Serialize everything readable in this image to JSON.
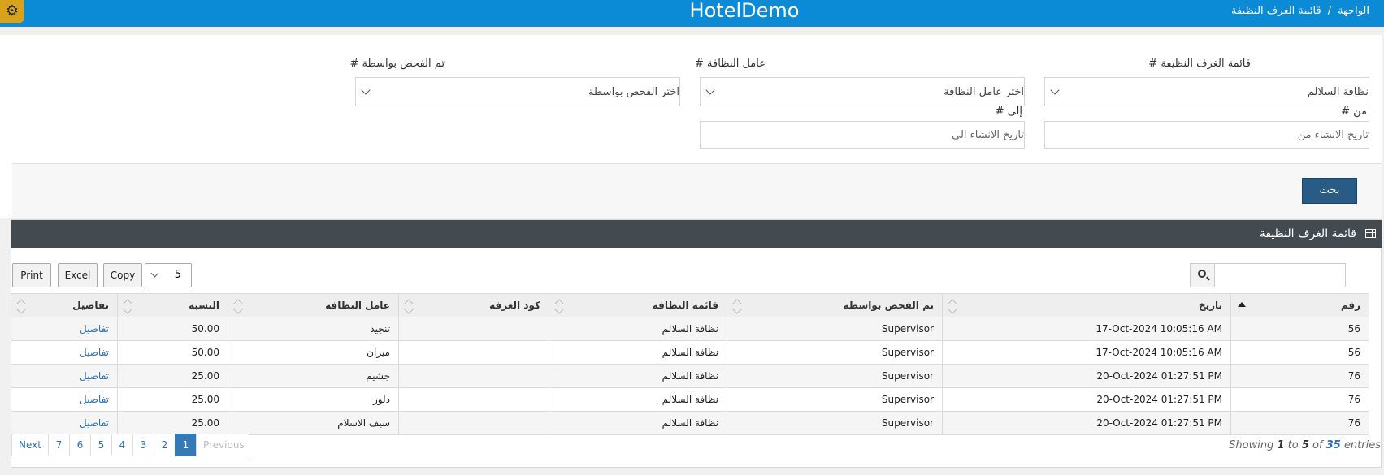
{
  "topbar": {
    "brand": "HotelDemo",
    "breadcrumb": [
      "الواجهة",
      "/",
      "قائمة الغرف النظيفة"
    ],
    "settings_icon": "gear-icon",
    "accent": "#0b8bd6"
  },
  "filters": {
    "list_label": "قائمة الغرف النظيفة #",
    "list_value": "نظافة السلالم",
    "worker_label": "عامل النظافة #",
    "worker_placeholder": "اختر عامل النظافة",
    "checked_label": "تم الفحص بواسطة #",
    "checked_placeholder": "اختر الفحص بواسطة",
    "from_label": "من #",
    "from_placeholder": "تاريخ الانشاء من",
    "to_label": "إلى #",
    "to_placeholder": "تاريخ الانشاء الى",
    "search_button": "بحث"
  },
  "panel": {
    "title": "قائمة الغرف النظيفة",
    "icon": "table-grid-icon"
  },
  "toolbar": {
    "print": "Print",
    "excel": "Excel",
    "copy": "Copy",
    "page_size": "5",
    "search_value": ""
  },
  "table": {
    "columns": [
      "رقم",
      "تاريخ",
      "تم الفحص بواسطة",
      "قائمة النظافة",
      "كود الغرفة",
      "عامل النظافة",
      "النسبة",
      "تفاصيل"
    ],
    "rows": [
      [
        "56",
        "17-Oct-2024 10:05:16 AM",
        "Supervisor",
        "نظافة السلالم",
        "",
        "تنجيد",
        "50.00",
        "تفاصيل"
      ],
      [
        "56",
        "17-Oct-2024 10:05:16 AM",
        "Supervisor",
        "نظافة السلالم",
        "",
        "ميزان",
        "50.00",
        "تفاصيل"
      ],
      [
        "76",
        "20-Oct-2024 01:27:51 PM",
        "Supervisor",
        "نظافة السلالم",
        "",
        "جشيم",
        "25.00",
        "تفاصيل"
      ],
      [
        "76",
        "20-Oct-2024 01:27:51 PM",
        "Supervisor",
        "نظافة السلالم",
        "",
        "دلور",
        "25.00",
        "تفاصيل"
      ],
      [
        "76",
        "20-Oct-2024 01:27:51 PM",
        "Supervisor",
        "نظافة السلالم",
        "",
        "سيف الاسلام",
        "25.00",
        "تفاصيل"
      ]
    ]
  },
  "pagination": {
    "next": "Next",
    "pages": [
      "7",
      "6",
      "5",
      "4",
      "3",
      "2",
      "1"
    ],
    "active": "1",
    "previous": "Previous"
  },
  "info": {
    "showing": "Showing",
    "from": "1",
    "to_word": "to",
    "to": "5",
    "of_word": "of",
    "total": "35",
    "entries": "entries"
  }
}
